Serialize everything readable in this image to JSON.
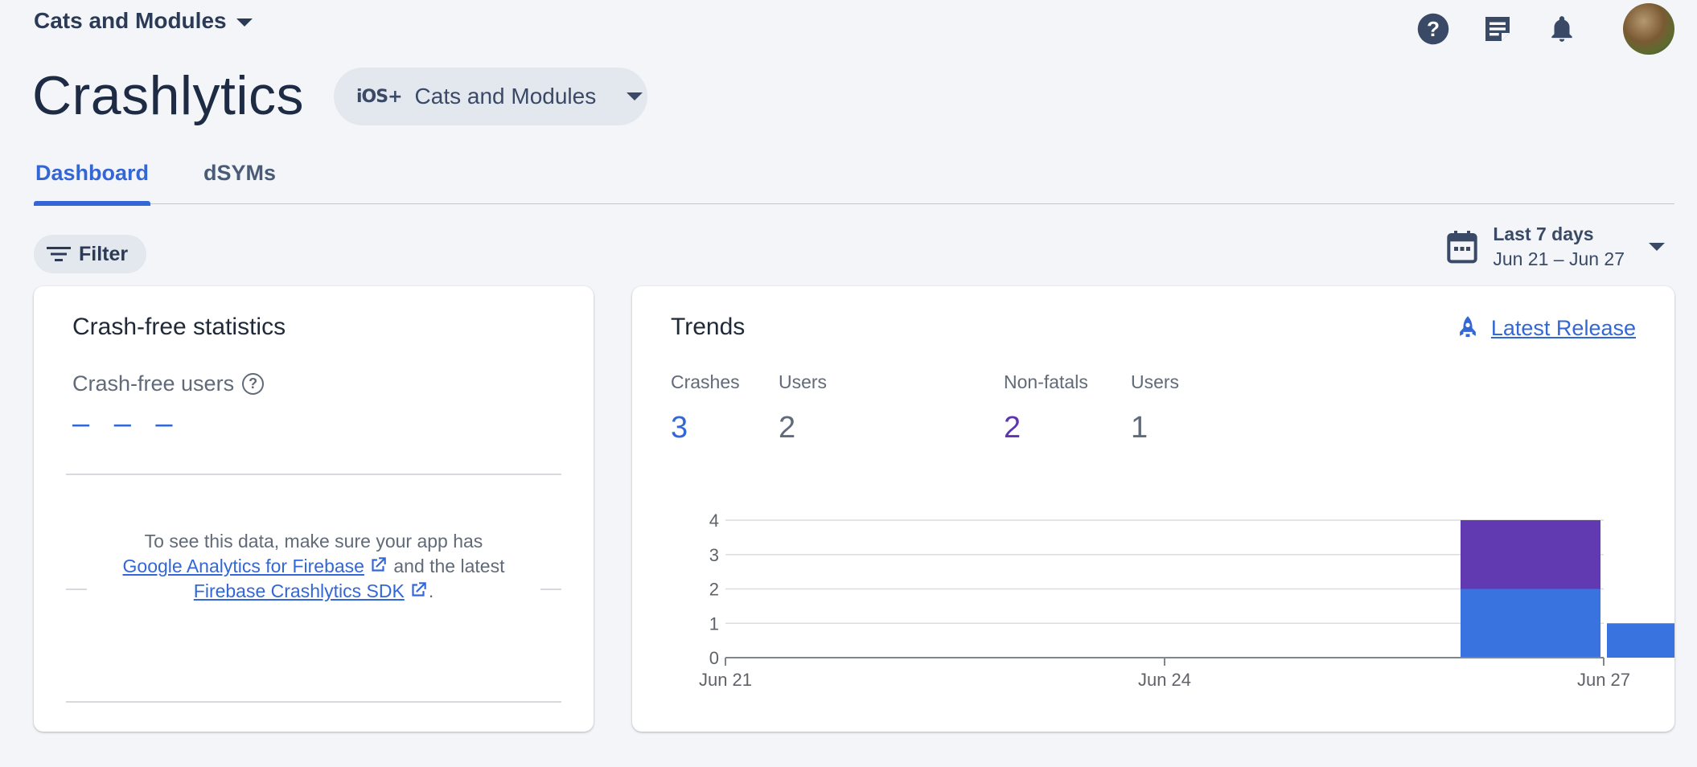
{
  "topbar": {
    "project_name": "Cats and Modules"
  },
  "page": {
    "title": "Crashlytics",
    "app_chip": {
      "platform": "iOS+",
      "app_name": "Cats and Modules"
    }
  },
  "tabs": [
    {
      "label": "Dashboard",
      "active": true
    },
    {
      "label": "dSYMs",
      "active": false
    }
  ],
  "filter": {
    "label": "Filter"
  },
  "date_range": {
    "label": "Last 7 days",
    "range": "Jun 21 – Jun 27"
  },
  "crash_free": {
    "title": "Crash-free statistics",
    "users_label": "Crash-free users",
    "users_value": "– – –",
    "message_pre": "To see this data, make sure your app has",
    "link1": "Google Analytics for Firebase",
    "message_mid": "and the latest",
    "link2": "Firebase Crashlytics SDK",
    "message_end": "."
  },
  "trends": {
    "title": "Trends",
    "latest_release": "Latest Release",
    "stats": [
      {
        "label": "Crashes",
        "value": "3",
        "color": "#3367d6"
      },
      {
        "label": "Users",
        "value": "2",
        "color": "#616a78"
      },
      {
        "label": "Non-fatals",
        "value": "2",
        "color": "#5e35b1"
      },
      {
        "label": "Users",
        "value": "1",
        "color": "#616a78"
      }
    ]
  },
  "colors": {
    "accent": "#3367d6",
    "crashes": "#3873e0",
    "nonfatals": "#6139b0"
  },
  "chart_data": {
    "type": "bar",
    "stacked": true,
    "x": [
      "Jun 21",
      "Jun 22",
      "Jun 23",
      "Jun 24",
      "Jun 25",
      "Jun 26",
      "Jun 27"
    ],
    "x_ticks": [
      "Jun 21",
      "Jun 24",
      "Jun 27"
    ],
    "series": [
      {
        "values": [
          0,
          0,
          0,
          0,
          0,
          2,
          1
        ],
        "color": "#3873e0"
      },
      {
        "values": [
          0,
          0,
          0,
          0,
          0,
          2,
          0
        ],
        "color": "#6139b0"
      }
    ],
    "ylim": [
      0,
      4
    ],
    "y_ticks": [
      0,
      1,
      2,
      3,
      4
    ],
    "grid": true
  }
}
